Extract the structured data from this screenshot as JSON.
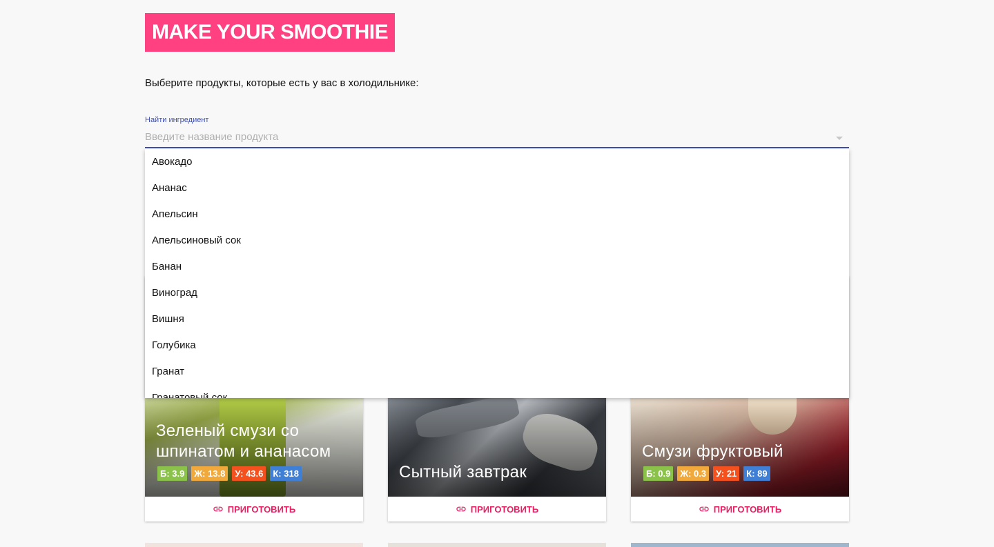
{
  "app": {
    "logo": "MAKE YOUR SMOOTHIE",
    "intro": "Выберите продукты, которые есть у вас в холодильнике:"
  },
  "search": {
    "label": "Найти ингредиент",
    "placeholder": "Введите название продукта",
    "value": ""
  },
  "menu": {
    "items": [
      "Авокадо",
      "Ананас",
      "Апельсин",
      "Апельсиновый сок",
      "Банан",
      "Виноград",
      "Вишня",
      "Голубика",
      "Гранат",
      "Гранатовый сок"
    ]
  },
  "cards": [
    {
      "title": "Зеленый смузи со шпинатом и ананасом",
      "badges": [
        {
          "text": "Б: 3.9",
          "color": "#8bc34a"
        },
        {
          "text": "Ж: 13.8",
          "color": "#f2a93b"
        },
        {
          "text": "У: 43.6",
          "color": "#f4511e"
        },
        {
          "text": "К: 318",
          "color": "#3f7fd6"
        }
      ],
      "action": "ПРИГОТОВИТЬ",
      "icon": "link-icon"
    },
    {
      "title": "Сытный завтрак",
      "badges": [],
      "action": "ПРИГОТОВИТЬ",
      "icon": "link-icon"
    },
    {
      "title": "Смузи фруктовый",
      "badges": [
        {
          "text": "Б: 0.9",
          "color": "#8bc34a"
        },
        {
          "text": "Ж: 0.3",
          "color": "#f2a93b"
        },
        {
          "text": "У: 21",
          "color": "#f4511e"
        },
        {
          "text": "К: 89",
          "color": "#3f7fd6"
        }
      ],
      "action": "ПРИГОТОВИТЬ",
      "icon": "link-icon"
    }
  ],
  "colors": {
    "accent": "#ff4081",
    "primary": "#3f51b5",
    "action": "#e91e63"
  }
}
